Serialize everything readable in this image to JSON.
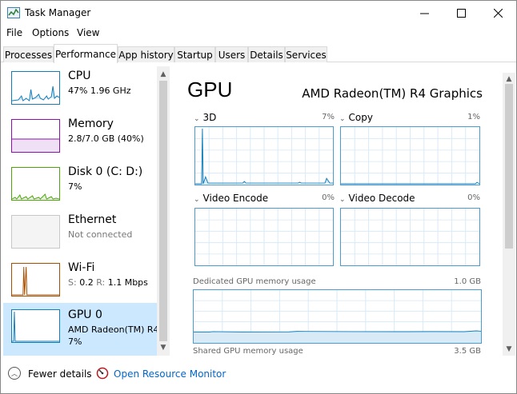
{
  "window": {
    "title": "Task Manager"
  },
  "menu": [
    "File",
    "Options",
    "View"
  ],
  "tabs": [
    "Processes",
    "Performance",
    "App history",
    "Startup",
    "Users",
    "Details",
    "Services"
  ],
  "active_tab": "Performance",
  "resources": [
    {
      "name": "CPU",
      "detail": "47%  1.96 GHz",
      "color": "#117dbb"
    },
    {
      "name": "Memory",
      "detail": "2.8/7.0 GB (40%)",
      "color": "#8b12ae"
    },
    {
      "name": "Disk 0 (C: D:)",
      "detail": "7%",
      "color": "#4da60c"
    },
    {
      "name": "Ethernet",
      "detail": "Not connected",
      "color": "#a0a0a0"
    },
    {
      "name": "Wi-Fi",
      "detail_parts": [
        "S:",
        "0.2",
        "R:",
        "1.1 Mbps"
      ],
      "color": "#a74f01"
    },
    {
      "name": "GPU 0",
      "detail": "AMD Radeon(TM) R4",
      "detail2": "7%",
      "color": "#117dbb"
    }
  ],
  "gpu": {
    "title": "GPU",
    "model": "AMD Radeon(TM) R4 Graphics",
    "engines": [
      {
        "label": "3D",
        "pct": "7%"
      },
      {
        "label": "Copy",
        "pct": "1%"
      },
      {
        "label": "Video Encode",
        "pct": "0%"
      },
      {
        "label": "Video Decode",
        "pct": "0%"
      }
    ],
    "dedicated_label": "Dedicated GPU memory usage",
    "dedicated_max": "1.0 GB",
    "shared_label": "Shared GPU memory usage",
    "shared_max": "3.5 GB"
  },
  "footer": {
    "fewer_details": "Fewer details",
    "open_resource_monitor": "Open Resource Monitor"
  },
  "colors": {
    "gpu_accent": "#117dbb",
    "selected_bg": "#cce8ff",
    "link": "#0066cc"
  }
}
